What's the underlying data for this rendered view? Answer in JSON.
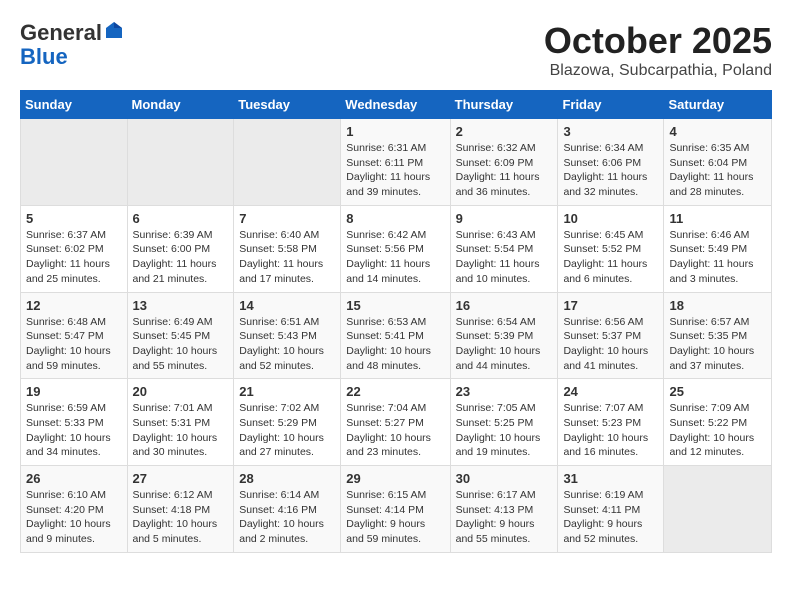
{
  "header": {
    "logo_general": "General",
    "logo_blue": "Blue",
    "month": "October 2025",
    "location": "Blazowa, Subcarpathia, Poland"
  },
  "weekdays": [
    "Sunday",
    "Monday",
    "Tuesday",
    "Wednesday",
    "Thursday",
    "Friday",
    "Saturday"
  ],
  "weeks": [
    [
      {
        "day": "",
        "info": ""
      },
      {
        "day": "",
        "info": ""
      },
      {
        "day": "",
        "info": ""
      },
      {
        "day": "1",
        "info": "Sunrise: 6:31 AM\nSunset: 6:11 PM\nDaylight: 11 hours\nand 39 minutes."
      },
      {
        "day": "2",
        "info": "Sunrise: 6:32 AM\nSunset: 6:09 PM\nDaylight: 11 hours\nand 36 minutes."
      },
      {
        "day": "3",
        "info": "Sunrise: 6:34 AM\nSunset: 6:06 PM\nDaylight: 11 hours\nand 32 minutes."
      },
      {
        "day": "4",
        "info": "Sunrise: 6:35 AM\nSunset: 6:04 PM\nDaylight: 11 hours\nand 28 minutes."
      }
    ],
    [
      {
        "day": "5",
        "info": "Sunrise: 6:37 AM\nSunset: 6:02 PM\nDaylight: 11 hours\nand 25 minutes."
      },
      {
        "day": "6",
        "info": "Sunrise: 6:39 AM\nSunset: 6:00 PM\nDaylight: 11 hours\nand 21 minutes."
      },
      {
        "day": "7",
        "info": "Sunrise: 6:40 AM\nSunset: 5:58 PM\nDaylight: 11 hours\nand 17 minutes."
      },
      {
        "day": "8",
        "info": "Sunrise: 6:42 AM\nSunset: 5:56 PM\nDaylight: 11 hours\nand 14 minutes."
      },
      {
        "day": "9",
        "info": "Sunrise: 6:43 AM\nSunset: 5:54 PM\nDaylight: 11 hours\nand 10 minutes."
      },
      {
        "day": "10",
        "info": "Sunrise: 6:45 AM\nSunset: 5:52 PM\nDaylight: 11 hours\nand 6 minutes."
      },
      {
        "day": "11",
        "info": "Sunrise: 6:46 AM\nSunset: 5:49 PM\nDaylight: 11 hours\nand 3 minutes."
      }
    ],
    [
      {
        "day": "12",
        "info": "Sunrise: 6:48 AM\nSunset: 5:47 PM\nDaylight: 10 hours\nand 59 minutes."
      },
      {
        "day": "13",
        "info": "Sunrise: 6:49 AM\nSunset: 5:45 PM\nDaylight: 10 hours\nand 55 minutes."
      },
      {
        "day": "14",
        "info": "Sunrise: 6:51 AM\nSunset: 5:43 PM\nDaylight: 10 hours\nand 52 minutes."
      },
      {
        "day": "15",
        "info": "Sunrise: 6:53 AM\nSunset: 5:41 PM\nDaylight: 10 hours\nand 48 minutes."
      },
      {
        "day": "16",
        "info": "Sunrise: 6:54 AM\nSunset: 5:39 PM\nDaylight: 10 hours\nand 44 minutes."
      },
      {
        "day": "17",
        "info": "Sunrise: 6:56 AM\nSunset: 5:37 PM\nDaylight: 10 hours\nand 41 minutes."
      },
      {
        "day": "18",
        "info": "Sunrise: 6:57 AM\nSunset: 5:35 PM\nDaylight: 10 hours\nand 37 minutes."
      }
    ],
    [
      {
        "day": "19",
        "info": "Sunrise: 6:59 AM\nSunset: 5:33 PM\nDaylight: 10 hours\nand 34 minutes."
      },
      {
        "day": "20",
        "info": "Sunrise: 7:01 AM\nSunset: 5:31 PM\nDaylight: 10 hours\nand 30 minutes."
      },
      {
        "day": "21",
        "info": "Sunrise: 7:02 AM\nSunset: 5:29 PM\nDaylight: 10 hours\nand 27 minutes."
      },
      {
        "day": "22",
        "info": "Sunrise: 7:04 AM\nSunset: 5:27 PM\nDaylight: 10 hours\nand 23 minutes."
      },
      {
        "day": "23",
        "info": "Sunrise: 7:05 AM\nSunset: 5:25 PM\nDaylight: 10 hours\nand 19 minutes."
      },
      {
        "day": "24",
        "info": "Sunrise: 7:07 AM\nSunset: 5:23 PM\nDaylight: 10 hours\nand 16 minutes."
      },
      {
        "day": "25",
        "info": "Sunrise: 7:09 AM\nSunset: 5:22 PM\nDaylight: 10 hours\nand 12 minutes."
      }
    ],
    [
      {
        "day": "26",
        "info": "Sunrise: 6:10 AM\nSunset: 4:20 PM\nDaylight: 10 hours\nand 9 minutes."
      },
      {
        "day": "27",
        "info": "Sunrise: 6:12 AM\nSunset: 4:18 PM\nDaylight: 10 hours\nand 5 minutes."
      },
      {
        "day": "28",
        "info": "Sunrise: 6:14 AM\nSunset: 4:16 PM\nDaylight: 10 hours\nand 2 minutes."
      },
      {
        "day": "29",
        "info": "Sunrise: 6:15 AM\nSunset: 4:14 PM\nDaylight: 9 hours\nand 59 minutes."
      },
      {
        "day": "30",
        "info": "Sunrise: 6:17 AM\nSunset: 4:13 PM\nDaylight: 9 hours\nand 55 minutes."
      },
      {
        "day": "31",
        "info": "Sunrise: 6:19 AM\nSunset: 4:11 PM\nDaylight: 9 hours\nand 52 minutes."
      },
      {
        "day": "",
        "info": ""
      }
    ]
  ]
}
